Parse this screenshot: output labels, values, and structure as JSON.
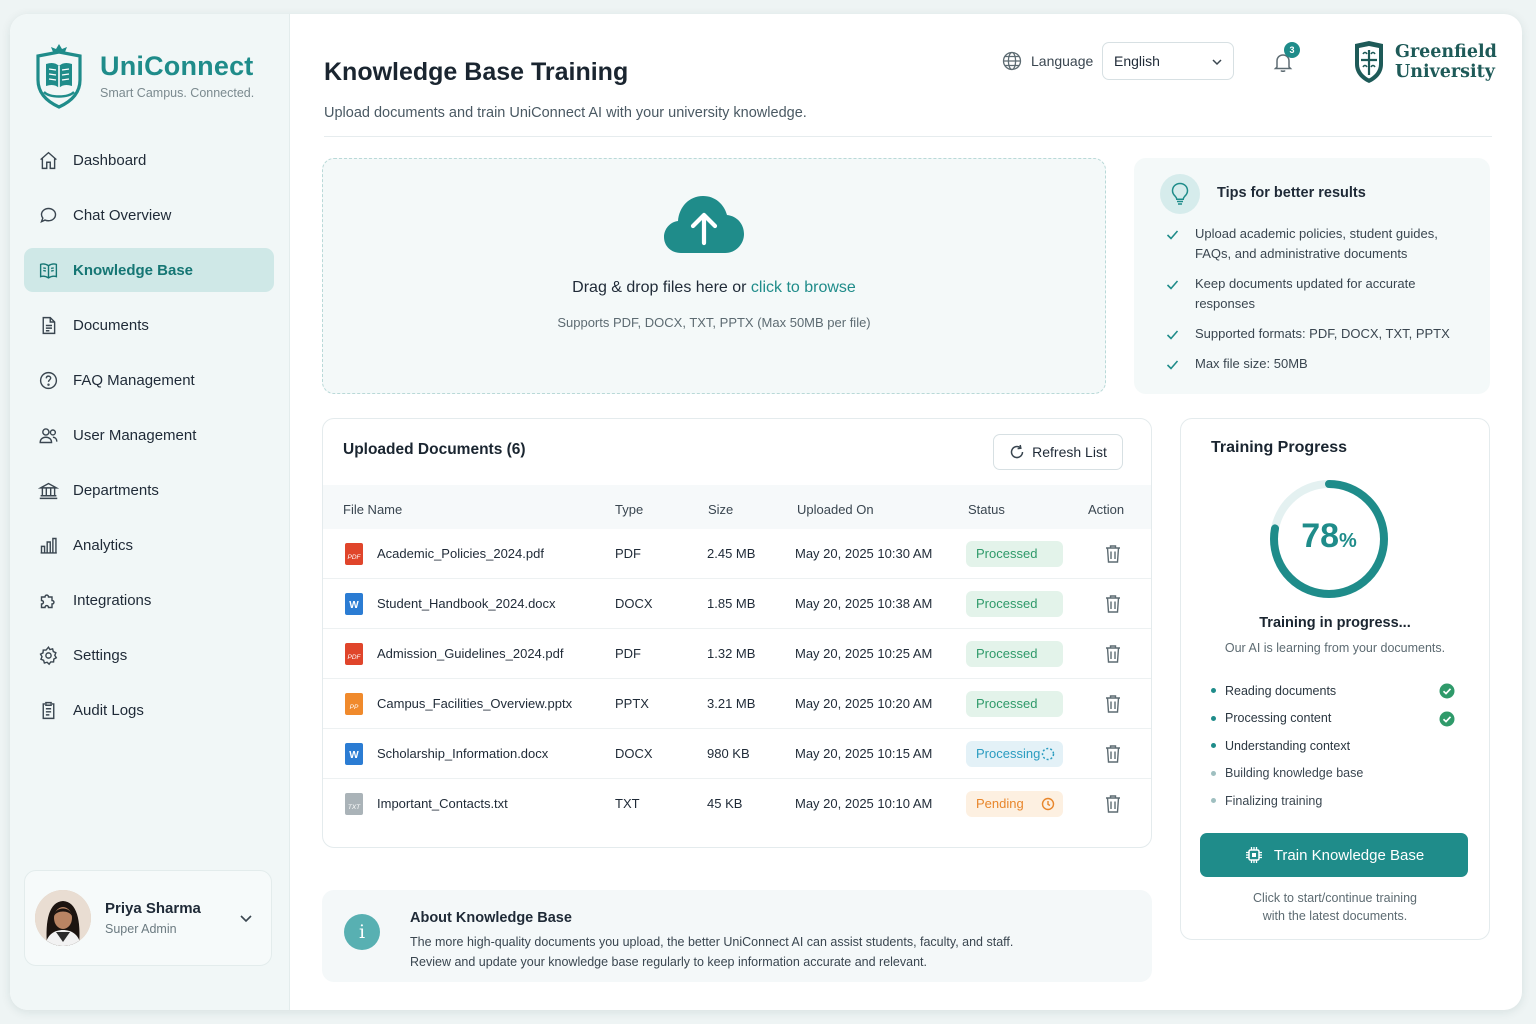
{
  "app": {
    "name": "UniConnect",
    "tagline": "Smart Campus. Connected.",
    "brand_color": "#1f8c8a"
  },
  "sidebar": {
    "items": [
      {
        "label": "Dashboard",
        "icon": "home-icon"
      },
      {
        "label": "Chat Overview",
        "icon": "chat-icon"
      },
      {
        "label": "Knowledge Base",
        "icon": "book-icon",
        "active": true
      },
      {
        "label": "Documents",
        "icon": "document-icon"
      },
      {
        "label": "FAQ Management",
        "icon": "help-circle-icon"
      },
      {
        "label": "User Management",
        "icon": "users-icon"
      },
      {
        "label": "Departments",
        "icon": "building-icon"
      },
      {
        "label": "Analytics",
        "icon": "bar-chart-icon"
      },
      {
        "label": "Integrations",
        "icon": "puzzle-icon"
      },
      {
        "label": "Settings",
        "icon": "gear-icon"
      },
      {
        "label": "Audit Logs",
        "icon": "clipboard-icon"
      }
    ],
    "user": {
      "name": "Priya Sharma",
      "role": "Super Admin"
    }
  },
  "header": {
    "title": "Knowledge Base Training",
    "subtitle": "Upload documents and train UniConnect AI with your university knowledge.",
    "language_label": "Language",
    "language_value": "English",
    "notification_count": "3",
    "university_line1": "Greenfield",
    "university_line2": "University"
  },
  "upload": {
    "prompt": "Drag & drop files here or ",
    "link": "click to browse",
    "hint": "Supports PDF, DOCX, TXT, PPTX (Max 50MB per file)"
  },
  "tips": {
    "title": "Tips for better results",
    "items": [
      "Upload academic policies, student guides, FAQs, and administrative documents",
      "Keep documents updated for accurate responses",
      "Supported formats: PDF, DOCX, TXT, PPTX",
      "Max file size: 50MB"
    ]
  },
  "documents": {
    "title": "Uploaded Documents (6)",
    "refresh_label": "Refresh List",
    "columns": [
      "File Name",
      "Type",
      "Size",
      "Uploaded On",
      "Status",
      "Action"
    ],
    "rows": [
      {
        "name": "Academic_Policies_2024.pdf",
        "type": "PDF",
        "size": "2.45 MB",
        "uploaded": "May 20, 2025 10:30 AM",
        "status": "Processed",
        "icon_label": "PDF"
      },
      {
        "name": "Student_Handbook_2024.docx",
        "type": "DOCX",
        "size": "1.85 MB",
        "uploaded": "May 20, 2025 10:38 AM",
        "status": "Processed",
        "icon_label": "W"
      },
      {
        "name": "Admission_Guidelines_2024.pdf",
        "type": "PDF",
        "size": "1.32 MB",
        "uploaded": "May 20, 2025 10:25 AM",
        "status": "Processed",
        "icon_label": "PDF"
      },
      {
        "name": "Campus_Facilities_Overview.pptx",
        "type": "PPTX",
        "size": "3.21 MB",
        "uploaded": "May 20, 2025 10:20 AM",
        "status": "Processed",
        "icon_label": "PP"
      },
      {
        "name": "Scholarship_Information.docx",
        "type": "DOCX",
        "size": "980 KB",
        "uploaded": "May 20, 2025 10:15 AM",
        "status": "Processing",
        "icon_label": "W"
      },
      {
        "name": "Important_Contacts.txt",
        "type": "TXT",
        "size": "45 KB",
        "uploaded": "May 20, 2025 10:10 AM",
        "status": "Pending",
        "icon_label": "TXT"
      }
    ]
  },
  "about": {
    "title": "About Knowledge Base",
    "line1": "The more high-quality documents you upload, the better UniConnect AI can assist students, faculty, and staff.",
    "line2": "Review and update your knowledge base regularly to keep information accurate and relevant."
  },
  "training": {
    "title": "Training Progress",
    "percent": 78,
    "percent_label": "78",
    "percent_sign": "%",
    "status": "Training in progress...",
    "subtitle": "Our AI is learning from your documents.",
    "steps": [
      {
        "label": "Reading documents",
        "done": true
      },
      {
        "label": "Processing content",
        "done": true
      },
      {
        "label": "Understanding context",
        "done": false,
        "current": true
      },
      {
        "label": "Building knowledge base",
        "done": false
      },
      {
        "label": "Finalizing training",
        "done": false
      }
    ],
    "button_label": "Train Knowledge Base",
    "hint_line1": "Click to start/continue training",
    "hint_line2": "with the latest documents."
  }
}
